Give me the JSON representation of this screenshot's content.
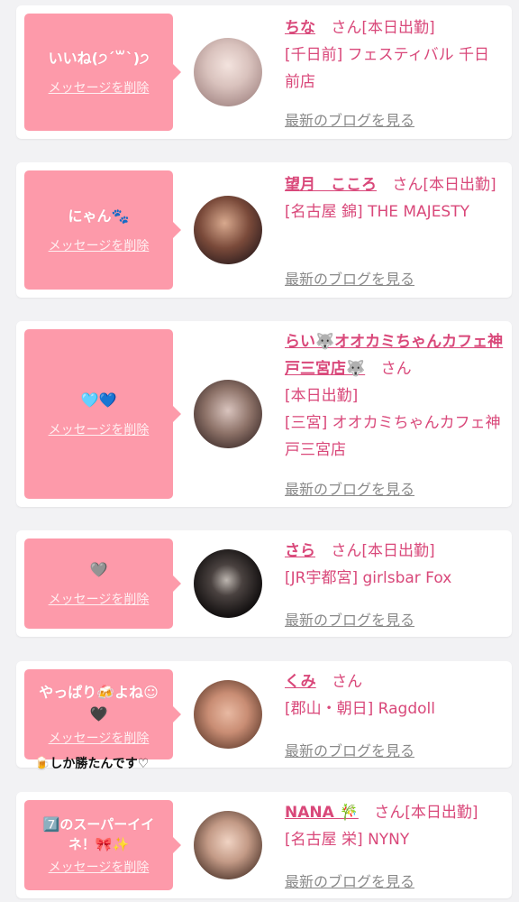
{
  "delete_label": "メッセージを削除",
  "blog_label": "最新のブログを見る",
  "san_label": "さん",
  "items": [
    {
      "message": "いいね(੭ˊ꒳ˋ)੭",
      "name": "ちな",
      "status": "[本日出勤]",
      "shop": "[千日前] フェスティバル 千日前店"
    },
    {
      "message": "にゃん🐾",
      "name": "望月　こころ",
      "status": "[本日出勤]",
      "shop": "[名古屋 錦] THE MAJESTY"
    },
    {
      "message": "🩵💙",
      "name": "らい🐺オオカミちゃんカフェ神戸三宮店🐺",
      "status": "[本日出勤]",
      "shop": "[三宮] オオカミちゃんカフェ神戸三宮店"
    },
    {
      "message": "🩶",
      "name": "さら",
      "status": "[本日出勤]",
      "shop": "[JR宇都宮] girlsbar Fox"
    },
    {
      "message": "やっぱり🍻よね☺︎\n🖤",
      "extra": "🍺しか勝たんです♡",
      "name": "くみ",
      "status": "",
      "shop": "[郡山・朝日] Ragdoll"
    },
    {
      "message": "7️⃣のスーパーイイネ！🎀✨",
      "name": "NANA 🎋",
      "status": "[本日出勤]",
      "shop": "[名古屋 栄] NYNY"
    }
  ]
}
